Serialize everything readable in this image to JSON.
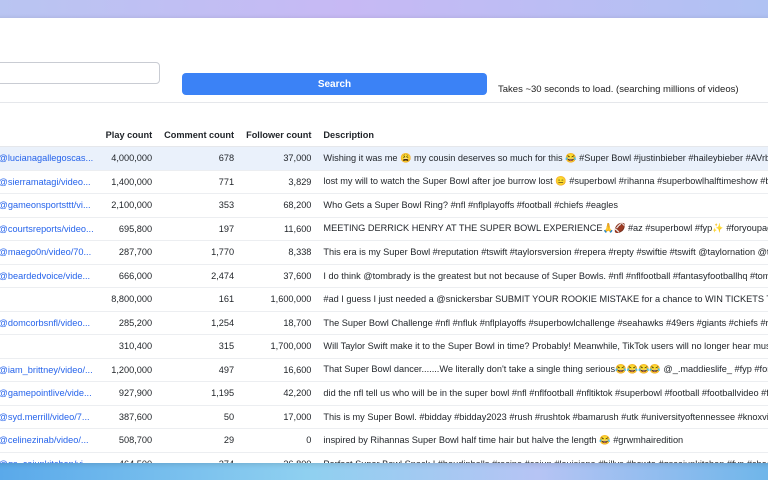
{
  "search": {
    "placeholder": "",
    "value": "",
    "button_label": "Search",
    "note": "Takes ~30 seconds to load. (searching millions of videos)"
  },
  "table": {
    "headers": {
      "url": "",
      "play": "Play count",
      "comment": "Comment count",
      "follower": "Follower count",
      "description": "Description"
    },
    "rows": [
      {
        "url": "/@lucianagallegoscas...",
        "play": "4,000,000",
        "comment": "678",
        "follower": "37,000",
        "description": "Wishing it was me 😩 my cousin deserves so much for this 😂 #Super Bowl #justinbieber #haileybieber #AVrboForTogether"
      },
      {
        "url": "/@sierramatagi/video...",
        "play": "1,400,000",
        "comment": "771",
        "follower": "3,829",
        "description": "lost my will to watch the Super Bowl after joe burrow lost 😑 #superbowl #rihanna #superbowlhalftimeshow #badgiririr"
      },
      {
        "url": "/@gameonsportsttt/vi...",
        "play": "2,100,000",
        "comment": "353",
        "follower": "68,200",
        "description": "Who Gets a Super Bowl Ring? #nfl #nflplayoffs #football #chiefs #eagles"
      },
      {
        "url": "/@courtsreports/video...",
        "play": "695,800",
        "comment": "197",
        "follower": "11,600",
        "description": "MEETING DERRICK HENRY AT THE SUPER BOWL EXPERIENCE🙏🏈 #az #superbowl #fyp✨ #foryoupage #sports #con"
      },
      {
        "url": "/@maego0n/video/70...",
        "play": "287,700",
        "comment": "1,770",
        "follower": "8,338",
        "description": "This era is my Super Bowl #reputation #tswift #taylorsversion #repera #repty #swiftie #tswift @taylornation @taylorswift"
      },
      {
        "url": "/@beardedvoice/vide...",
        "play": "666,000",
        "comment": "2,474",
        "follower": "37,600",
        "description": "I do think @tombrady is the greatest but not because of Super Bowls. #nfl #nflfootball #fantasyfootballhq #tombrady #nflt"
      },
      {
        "url": "",
        "play": "8,800,000",
        "comment": "161",
        "follower": "1,600,000",
        "description": "#ad I guess I just needed a @snickersbar SUBMIT YOUR ROOKIE MISTAKE for a chance to WIN TICKETS TO Super Bowl"
      },
      {
        "url": "/@domcorbsnfl/video...",
        "play": "285,200",
        "comment": "1,254",
        "follower": "18,700",
        "description": "The Super Bowl Challenge #nfl #nfluk #nflplayoffs #superbowlchallenge #seahawks #49ers #giants #chiefs #ravens #ber"
      },
      {
        "url": "",
        "play": "310,400",
        "comment": "315",
        "follower": "1,700,000",
        "description": "Will Taylor Swift make it to the Super Bowl in time? Probably!   Meanwhile, TikTok users will no longer hear music from ar"
      },
      {
        "url": "/@iam_brittney/video/...",
        "play": "1,200,000",
        "comment": "497",
        "follower": "16,600",
        "description": "That Super Bowl dancer.......We literally don't take a single thing serious😂😂😂😂 @_.maddieslife_ #fyp #foryou #rihanna"
      },
      {
        "url": "/@gamepointlive/vide...",
        "play": "927,900",
        "comment": "1,195",
        "follower": "42,200",
        "description": "did the nfl tell us who will be in the super bowl #nfl #nflfootball #nfltiktok #superbowl #football #footballvideo #footballti"
      },
      {
        "url": "/@syd.merrill/video/7...",
        "play": "387,600",
        "comment": "50",
        "follower": "17,000",
        "description": "This is my Super Bowl. #bidday #bidday2023 #rush #rushtok #bamarush #utk #universityoftennessee #knoxville #sororit"
      },
      {
        "url": "/@celinezinab/video/...",
        "play": "508,700",
        "comment": "29",
        "follower": "0",
        "description": "inspired by Rihannas Super Bowl half time hair but halve the length 😂 #grwmhairedition"
      },
      {
        "url": "/@gs_cajunkitchen/vi...",
        "play": "464,500",
        "comment": "274",
        "follower": "36,800",
        "description": "Perfect Super Bowl Snack ! #boudinballs #recipe #cajun #louisiana #billys #howto #gscajunkitchen #fyp #cheesy #spicy"
      }
    ]
  }
}
